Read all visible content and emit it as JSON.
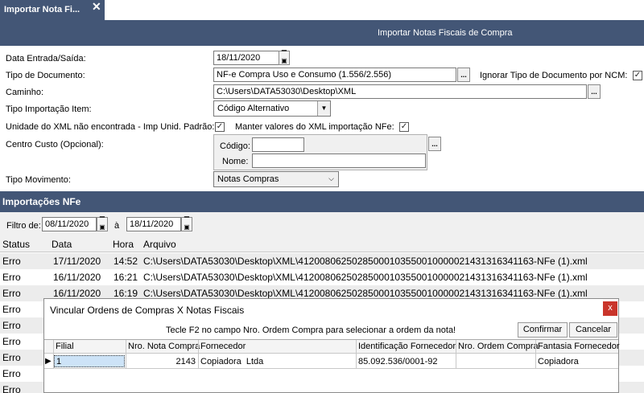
{
  "tab": {
    "label": "Importar Nota Fi...",
    "close": "✕"
  },
  "header": {
    "title": "Importar Notas Fiscais de Compra"
  },
  "form": {
    "data_label": "Data Entrada/Saída:",
    "data_value": "18/11/2020",
    "tipo_doc_label": "Tipo de Documento:",
    "tipo_doc_value": "NF-e Compra Uso e Consumo (1.556/2.556)",
    "ignorar_label": "Ignorar Tipo de Documento por NCM:",
    "ignorar_checked": "✓",
    "caminho_label": "Caminho:",
    "caminho_value": "C:\\Users\\DATA53030\\Desktop\\XML",
    "tipo_import_label": "Tipo Importação Item:",
    "tipo_import_value": "Código Alternativo",
    "unidade_label": "Unidade do XML não encontrada - Imp Unid. Padrão:",
    "unidade_checked": "✓",
    "manter_label": "Manter valores do XML importação NFe:",
    "manter_checked": "✓",
    "centro_label": "Centro Custo (Opcional):",
    "codigo_label": "Código:",
    "codigo_value": "",
    "nome_label": "Nome:",
    "nome_value": "",
    "tipo_mov_label": "Tipo Movimento:",
    "tipo_mov_value": "Notas Compras",
    "dots": "..."
  },
  "imports": {
    "title": "Importações NFe",
    "filtro_label": "Filtro de:",
    "filtro_from": "08/11/2020",
    "filtro_sep": "à",
    "filtro_to": "18/11/2020",
    "columns": [
      "Status",
      "Data",
      "Hora",
      "Arquivo"
    ],
    "rows": [
      {
        "status": "Erro",
        "data": "17/11/2020",
        "hora": "14:52",
        "arquivo": "C:\\Users\\DATA53030\\Desktop\\XML\\41200806250285000103550010000021431316341163-NFe (1).xml"
      },
      {
        "status": "Erro",
        "data": "16/11/2020",
        "hora": "16:21",
        "arquivo": "C:\\Users\\DATA53030\\Desktop\\XML\\41200806250285000103550010000021431316341163-NFe (1).xml"
      },
      {
        "status": "Erro",
        "data": "16/11/2020",
        "hora": "16:19",
        "arquivo": "C:\\Users\\DATA53030\\Desktop\\XML\\41200806250285000103550010000021431316341163-NFe (1).xml"
      },
      {
        "status": "Erro",
        "data": "",
        "hora": "",
        "arquivo": ""
      },
      {
        "status": "Erro",
        "data": "",
        "hora": "",
        "arquivo": ""
      },
      {
        "status": "Erro",
        "data": "",
        "hora": "",
        "arquivo": ""
      },
      {
        "status": "Erro",
        "data": "",
        "hora": "",
        "arquivo": ""
      },
      {
        "status": "Erro",
        "data": "",
        "hora": "",
        "arquivo": ""
      },
      {
        "status": "Erro",
        "data": "",
        "hora": "",
        "arquivo": ""
      }
    ]
  },
  "dialog": {
    "title": "Vincular Ordens de Compras X Notas Fiscais",
    "close": "x",
    "hint": "Tecle F2 no campo Nro. Ordem Compra para selecionar a ordem da nota!",
    "confirm": "Confirmar",
    "cancel": "Cancelar",
    "columns": [
      "Filial",
      "Nro. Nota Compra",
      "Fornecedor",
      "Identificação Fornecedor",
      "Nro. Ordem Compra",
      "Fantasia Fornecedor"
    ],
    "row": {
      "pointer": "▶",
      "filial": "1",
      "nro_nota": "2143",
      "fornecedor": "Copiadora  Ltda",
      "identificacao": "85.092.536/0001-92",
      "nro_ordem": "",
      "fantasia": "Copiadora"
    }
  }
}
